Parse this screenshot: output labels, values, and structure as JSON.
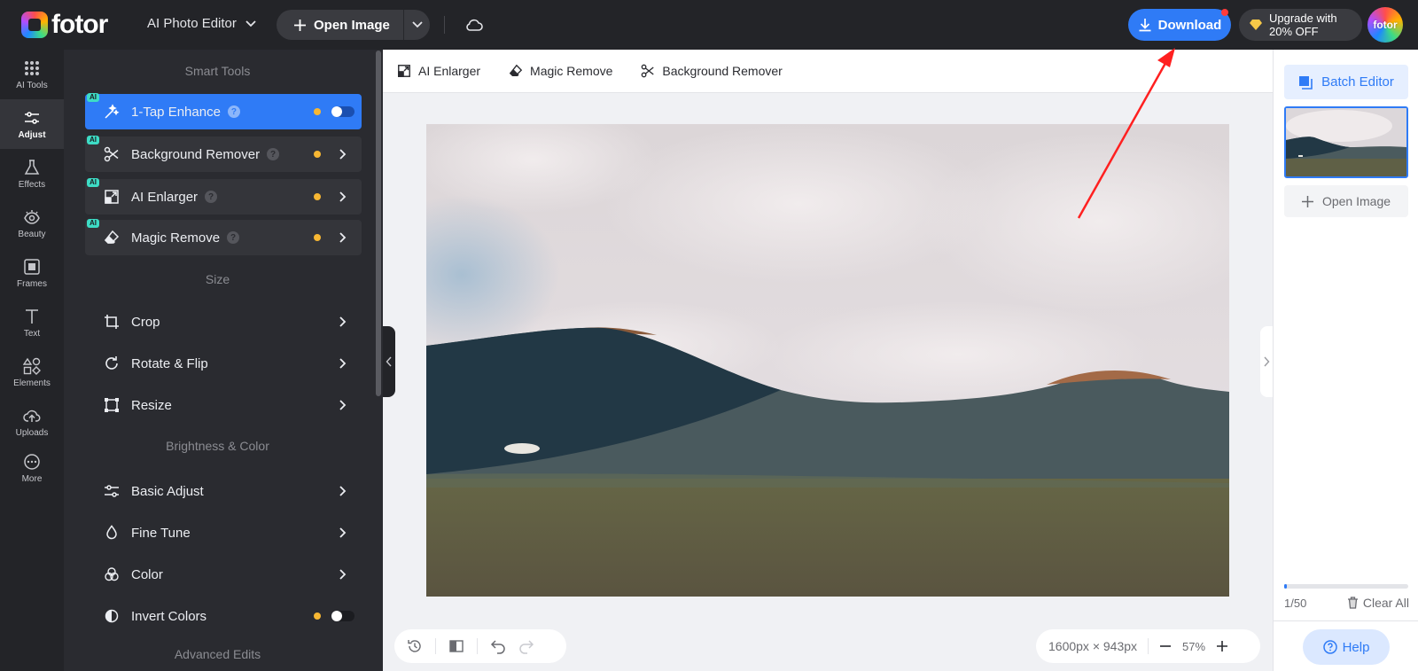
{
  "topbar": {
    "logo_text": "fotor",
    "editor_mode": "AI Photo Editor",
    "open_image_label": "Open Image",
    "download_label": "Download",
    "upgrade_label_line1": "Upgrade with",
    "upgrade_label_line2": "20% OFF",
    "avatar_text": "fotor"
  },
  "rail": {
    "items": [
      {
        "label": "AI Tools",
        "icon": "grid-dots-icon"
      },
      {
        "label": "Adjust",
        "icon": "sliders-icon",
        "active": true
      },
      {
        "label": "Effects",
        "icon": "flask-icon"
      },
      {
        "label": "Beauty",
        "icon": "eye-icon"
      },
      {
        "label": "Frames",
        "icon": "frame-icon"
      },
      {
        "label": "Text",
        "icon": "text-icon"
      },
      {
        "label": "Elements",
        "icon": "shapes-icon"
      },
      {
        "label": "Uploads",
        "icon": "cloud-upload-icon"
      },
      {
        "label": "More",
        "icon": "more-icon"
      }
    ]
  },
  "panel": {
    "sections": {
      "smart_tools": "Smart Tools",
      "size": "Size",
      "brightness_color": "Brightness & Color",
      "advanced_edits": "Advanced Edits"
    },
    "smart_tools": [
      {
        "label": "1-Tap Enhance",
        "badge": "AI"
      },
      {
        "label": "Background Remover",
        "badge": "AI"
      },
      {
        "label": "AI Enlarger",
        "badge": "AI"
      },
      {
        "label": "Magic Remove",
        "badge": "AI"
      }
    ],
    "size_tools": [
      "Crop",
      "Rotate & Flip",
      "Resize"
    ],
    "color_tools": [
      "Basic Adjust",
      "Fine Tune",
      "Color",
      "Invert Colors"
    ],
    "help_glyph": "?"
  },
  "quickbar": {
    "items": [
      "AI Enlarger",
      "Magic Remove",
      "Background Remover"
    ]
  },
  "canvas": {
    "dimensions": "1600px × 943px",
    "zoom": "57%"
  },
  "right_panel": {
    "batch_editor_label": "Batch Editor",
    "open_image_label": "Open Image",
    "count": "1/50",
    "progress": 0.02,
    "clear_all_label": "Clear All",
    "help_label": "Help"
  },
  "colors": {
    "accent": "#2f7bf6",
    "dark_bg": "#232428",
    "panel_bg": "#2a2b30",
    "dot": "#f7b733",
    "annotation": "#ff2020"
  }
}
